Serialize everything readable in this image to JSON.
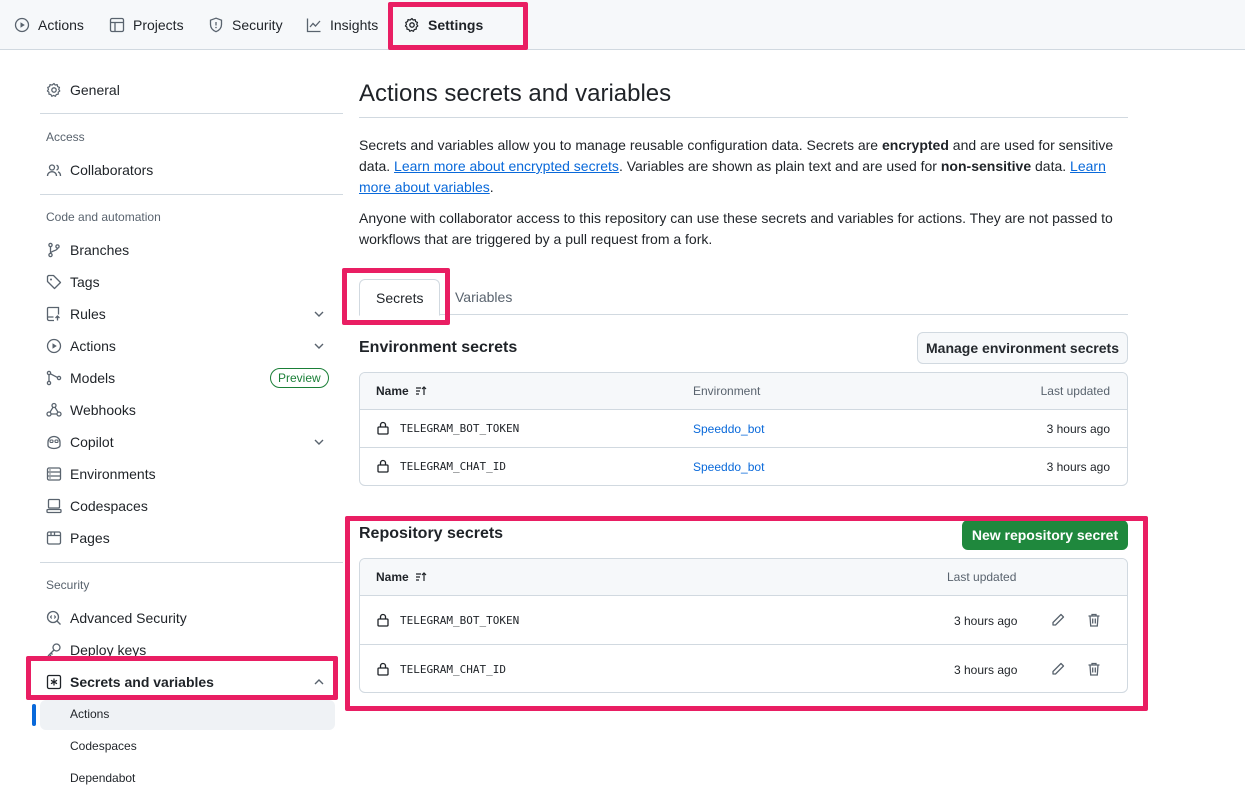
{
  "colors": {
    "highlight": "#e91e63",
    "accent": "#0969da",
    "primary_button": "#1f883d",
    "badge": "#1a7f37"
  },
  "topnav": {
    "items": [
      {
        "label": "Actions",
        "icon": "play-circle-icon"
      },
      {
        "label": "Projects",
        "icon": "table-icon"
      },
      {
        "label": "Security",
        "icon": "shield-icon"
      },
      {
        "label": "Insights",
        "icon": "graph-icon"
      },
      {
        "label": "Settings",
        "icon": "gear-icon",
        "active": true
      }
    ]
  },
  "sidebar": {
    "general": "General",
    "sections": {
      "access": "Access",
      "code_automation": "Code and automation",
      "security": "Security"
    },
    "items": {
      "collaborators": "Collaborators",
      "branches": "Branches",
      "tags": "Tags",
      "rules": "Rules",
      "actions": "Actions",
      "models": "Models",
      "webhooks": "Webhooks",
      "copilot": "Copilot",
      "environments": "Environments",
      "codespaces": "Codespaces",
      "pages": "Pages",
      "advanced_security": "Advanced Security",
      "deploy_keys": "Deploy keys",
      "secrets_and_variables": "Secrets and variables"
    },
    "models_badge": "Preview",
    "sub_items": [
      "Actions",
      "Codespaces",
      "Dependabot"
    ],
    "active_sub_item": "Actions"
  },
  "main": {
    "title": "Actions secrets and variables",
    "para1": {
      "t1": "Secrets and variables allow you to manage reusable configuration data. Secrets are ",
      "b1": "encrypted",
      "t2": " and are used for sensitive data. ",
      "link1": "Learn more about encrypted secrets",
      "t3": ". Variables are shown as plain text and are used for ",
      "b2": "non-sensitive",
      "t4": " data. ",
      "link2": "Learn more about variables",
      "t5": "."
    },
    "para2": "Anyone with collaborator access to this repository can use these secrets and variables for actions. They are not passed to workflows that are triggered by a pull request from a fork.",
    "tabs": [
      "Secrets",
      "Variables"
    ],
    "active_tab": "Secrets",
    "environment_secrets": {
      "title": "Environment secrets",
      "button": "Manage environment secrets",
      "columns": {
        "name": "Name",
        "environment": "Environment",
        "updated": "Last updated"
      },
      "rows": [
        {
          "name": "TELEGRAM_BOT_TOKEN",
          "environment": "Speeddo_bot",
          "updated": "3 hours ago"
        },
        {
          "name": "TELEGRAM_CHAT_ID",
          "environment": "Speeddo_bot",
          "updated": "3 hours ago"
        }
      ]
    },
    "repository_secrets": {
      "title": "Repository secrets",
      "button": "New repository secret",
      "columns": {
        "name": "Name",
        "updated": "Last updated"
      },
      "rows": [
        {
          "name": "TELEGRAM_BOT_TOKEN",
          "updated": "3 hours ago"
        },
        {
          "name": "TELEGRAM_CHAT_ID",
          "updated": "3 hours ago"
        }
      ]
    }
  }
}
